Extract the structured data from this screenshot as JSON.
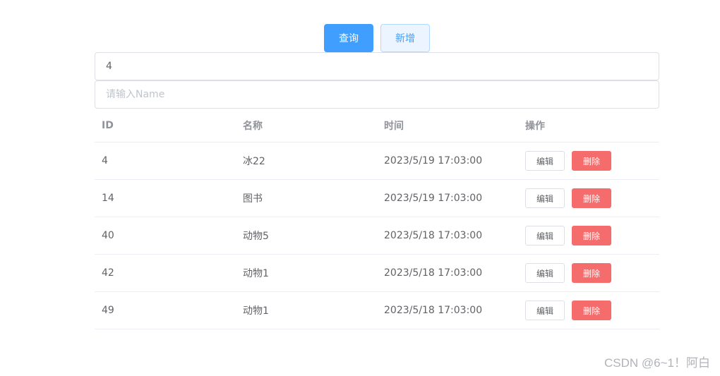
{
  "toolbar": {
    "query_label": "查询",
    "add_label": "新增"
  },
  "search": {
    "id_value": "4",
    "id_placeholder": "",
    "name_value": "",
    "name_placeholder": "请输入Name"
  },
  "table": {
    "headers": [
      "ID",
      "名称",
      "时间",
      "操作"
    ],
    "edit_label": "编辑",
    "delete_label": "删除",
    "rows": [
      {
        "id": "4",
        "name": "冰22",
        "time": "2023/5/19 17:03:00"
      },
      {
        "id": "14",
        "name": "图书",
        "time": "2023/5/19 17:03:00"
      },
      {
        "id": "40",
        "name": "动物5",
        "time": "2023/5/18 17:03:00"
      },
      {
        "id": "42",
        "name": "动物1",
        "time": "2023/5/18 17:03:00"
      },
      {
        "id": "49",
        "name": "动物1",
        "time": "2023/5/18 17:03:00"
      }
    ]
  },
  "watermark": "CSDN @6~1！阿白",
  "colors": {
    "primary": "#409eff",
    "danger": "#f56c6c",
    "border": "#dcdfe6"
  }
}
